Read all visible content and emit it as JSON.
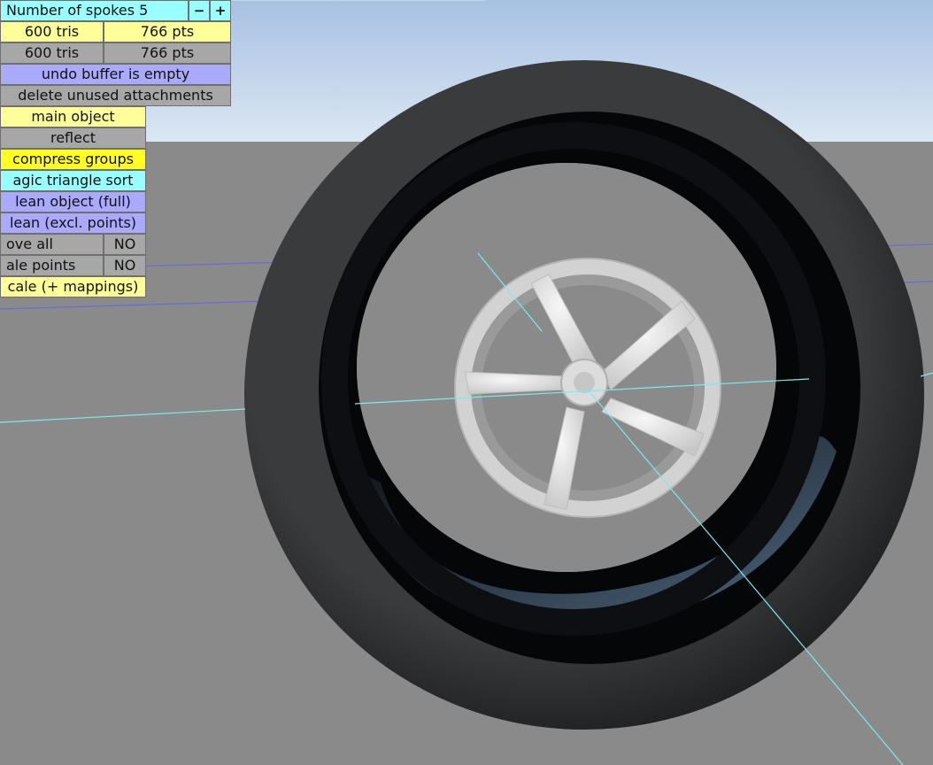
{
  "panel": {
    "spokes_label": "Number of spokes 5",
    "minus_label": "−",
    "plus_label": "+",
    "row1_tris": "600 tris",
    "row1_pts": "766 pts",
    "row2_tris": "600 tris",
    "row2_pts": "766 pts",
    "undo_status": "undo buffer is empty",
    "delete_unused": "delete unused attachments",
    "main_object": "main object",
    "reflect": "reflect",
    "compress_groups": "compress groups",
    "magic_sort": "agic triangle sort",
    "clean_full": "lean object (full)",
    "clean_excl": "lean (excl. points)",
    "move_all": "ove all",
    "move_all_value": "NO",
    "scale_points": "ale points",
    "scale_points_value": "NO",
    "scale_mappings": "cale (+ mappings)"
  },
  "colors": {
    "sky_top": "#a9c3e3",
    "ground": "#8a8a8a",
    "tire": "#2c2d2f",
    "rim": "#e6e6e6",
    "axis_line": "#7fe9ee",
    "grid_line": "#6a6adf"
  }
}
